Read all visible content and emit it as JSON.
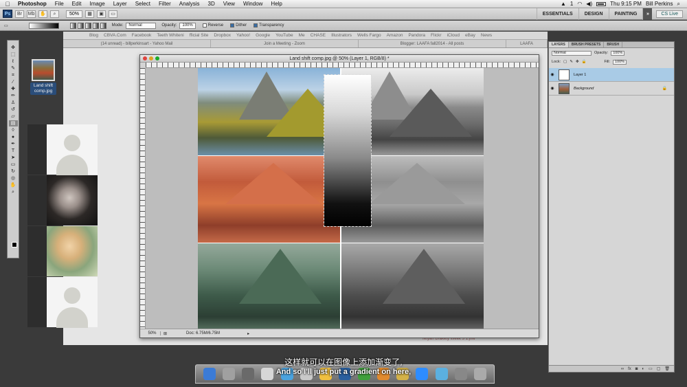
{
  "menubar": {
    "app": "Photoshop",
    "items": [
      "File",
      "Edit",
      "Image",
      "Layer",
      "Select",
      "Filter",
      "Analysis",
      "3D",
      "View",
      "Window",
      "Help"
    ],
    "status": {
      "clock": "Thu 9:15 PM",
      "user": "Bill Perkins",
      "badge": "1"
    }
  },
  "appbar": {
    "zoom": "50%",
    "workspaces": [
      "ESSENTIALS",
      "DESIGN",
      "PAINTING"
    ],
    "cslive": "CS Live"
  },
  "options": {
    "mode_label": "Mode:",
    "mode_value": "Normal",
    "opacity_label": "Opacity:",
    "opacity_value": "100%",
    "reverse": "Reverse",
    "dither": "Dither",
    "transparency": "Transparency"
  },
  "browser": {
    "bookmarks": [
      "Blog",
      "CBVA.Com",
      "Facebook",
      "Teeth Whiteni",
      "fficial Site",
      "Dropbox",
      "Yahoo!",
      "Google",
      "YouTube",
      "Me",
      "CHASE",
      "Illustrators",
      "Wells Fargo",
      "Amazon",
      "Pandora",
      "Flickr",
      "iCloud",
      "eBay",
      "News"
    ],
    "tabs": [
      "(14 unread) - billperkinsart - Yahoo Mail",
      "Join a Meeting - Zoom",
      "Blogger: LAAFA fall2014 - All posts"
    ],
    "top_right": "LAAFA",
    "caption": "Tetyan Drakety Week 3 1.jhw"
  },
  "desktop_file": {
    "label": "Land shift comp.jpg"
  },
  "document": {
    "title": "Land shift comp.jpg @ 50% (Layer 1, RGB/8) *",
    "status_zoom": "50%",
    "status_doc": "Doc: 6.75M/6.75M"
  },
  "layers_panel": {
    "tabs": [
      "LAYERS",
      "BRUSH PRESETS",
      "BRUSH"
    ],
    "blend_mode": "Normal",
    "opacity_label": "Opacity:",
    "opacity": "100%",
    "lock_label": "Lock:",
    "fill_label": "Fill:",
    "fill": "100%",
    "layers": [
      {
        "name": "Layer 1",
        "selected": true
      },
      {
        "name": "Background",
        "selected": false
      }
    ]
  },
  "subtitles": {
    "cn": "这样就可以在图像上添加渐变了,",
    "en": "And so I'll just put a gradient on here,"
  }
}
